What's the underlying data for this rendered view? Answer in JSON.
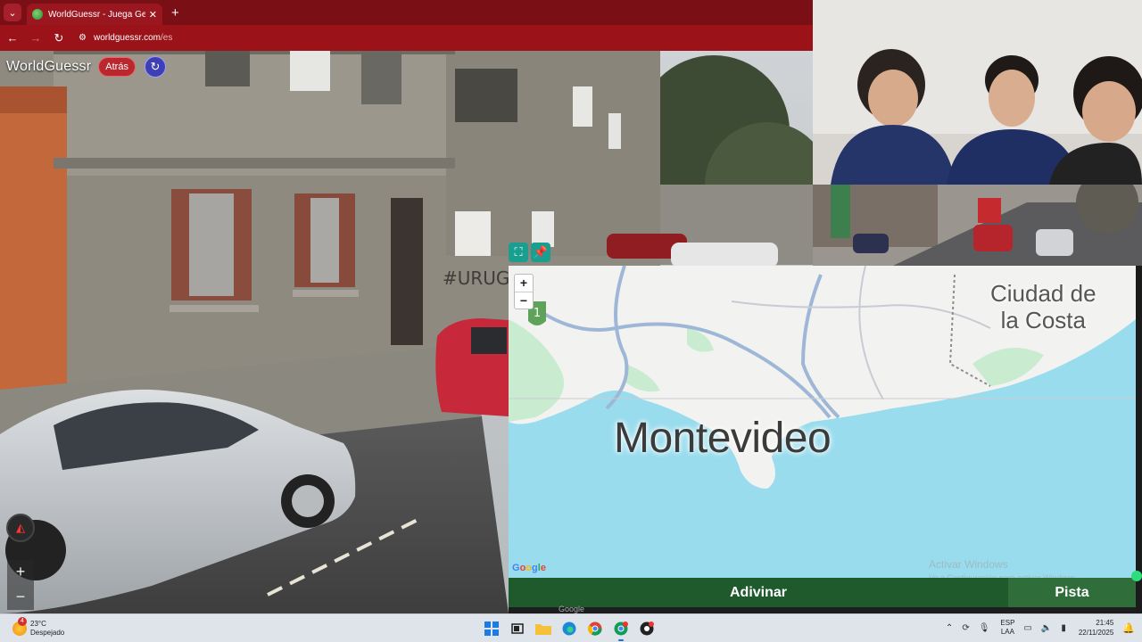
{
  "browser": {
    "tab_title": "WorldGuessr - Juega GeoGuess",
    "tab_close": "✕",
    "new_tab": "+",
    "url_host": "worldguessr.com",
    "url_path": "/es"
  },
  "game": {
    "logo": "WorldGuessr",
    "back_button": "Atrás",
    "street_graffiti": "#URUGUAYNO",
    "map": {
      "zoom_in": "+",
      "zoom_out": "−",
      "city_main": "Montevideo",
      "city_secondary_line1": "Ciudad de",
      "city_secondary_line2": "la Costa",
      "route_badge": "1",
      "attribution": "Google"
    },
    "guess_button": "Adivinar",
    "hint_button": "Pista",
    "sv_zoom_in": "+",
    "sv_zoom_out": "−"
  },
  "watermark": {
    "title": "Activar Windows",
    "subtitle": "Ve a Configuración para activar Windows."
  },
  "taskbar": {
    "weather_temp": "23°C",
    "weather_desc": "Despejado",
    "weather_badge": "4",
    "lang_line1": "ESP",
    "lang_line2": "LAA",
    "time": "21:45",
    "date": "22/11/2025"
  },
  "colors": {
    "browser_accent": "#9b1219",
    "map_water": "#98dced",
    "guess_button": "#1f5a2d",
    "hint_button": "#2f6e3a"
  },
  "icons": [
    "chevron-down-icon",
    "globe-favicon-icon",
    "close-icon",
    "plus-icon",
    "back-arrow-icon",
    "forward-arrow-icon",
    "reload-icon",
    "site-settings-icon",
    "reload-game-icon",
    "fullscreen-icon",
    "pin-icon",
    "compass-icon",
    "windows-start-icon",
    "task-view-icon",
    "folder-icon",
    "edge-icon",
    "chrome-icon",
    "obs-icon",
    "wifi-icon",
    "volume-icon",
    "battery-icon",
    "bell-icon"
  ]
}
